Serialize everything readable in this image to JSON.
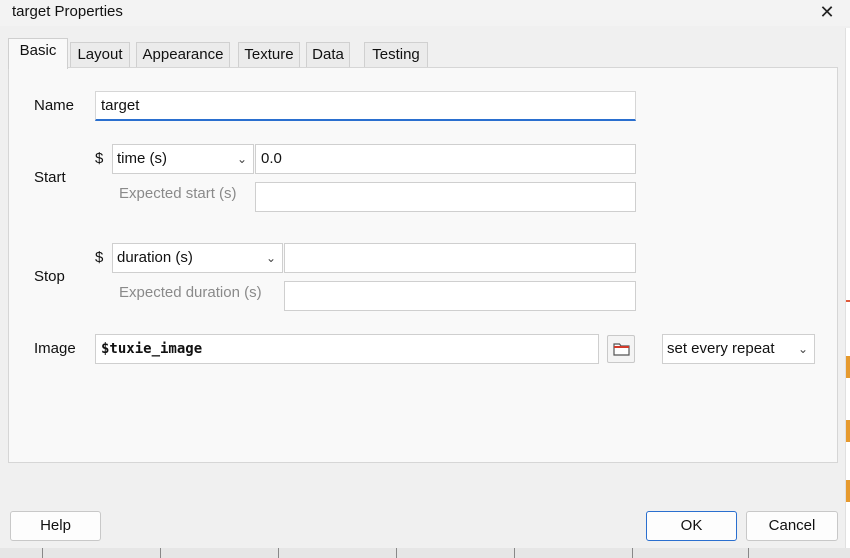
{
  "window": {
    "title": "target Properties",
    "close_glyph": "✕"
  },
  "tabs": [
    {
      "label": "Basic",
      "active": true
    },
    {
      "label": "Layout"
    },
    {
      "label": "Appearance"
    },
    {
      "label": "Texture"
    },
    {
      "label": "Data"
    },
    {
      "label": "Testing"
    }
  ],
  "form": {
    "name": {
      "label": "Name",
      "value": "target"
    },
    "start": {
      "label": "Start",
      "dollar": "$",
      "type_select": "time (s)",
      "value": "0.0",
      "expected_label": "Expected start (s)",
      "expected_value": ""
    },
    "stop": {
      "label": "Stop",
      "dollar": "$",
      "type_select": "duration (s)",
      "value": "",
      "expected_label": "Expected duration (s)",
      "expected_value": ""
    },
    "image": {
      "label": "Image",
      "value": "$tuxie_image",
      "browse_icon": "folder-icon",
      "update_select": "set every repeat"
    }
  },
  "buttons": {
    "help": "Help",
    "ok": "OK",
    "cancel": "Cancel"
  },
  "colors": {
    "accent": "#2a6fcf",
    "hint_text": "#8a8a8a"
  }
}
